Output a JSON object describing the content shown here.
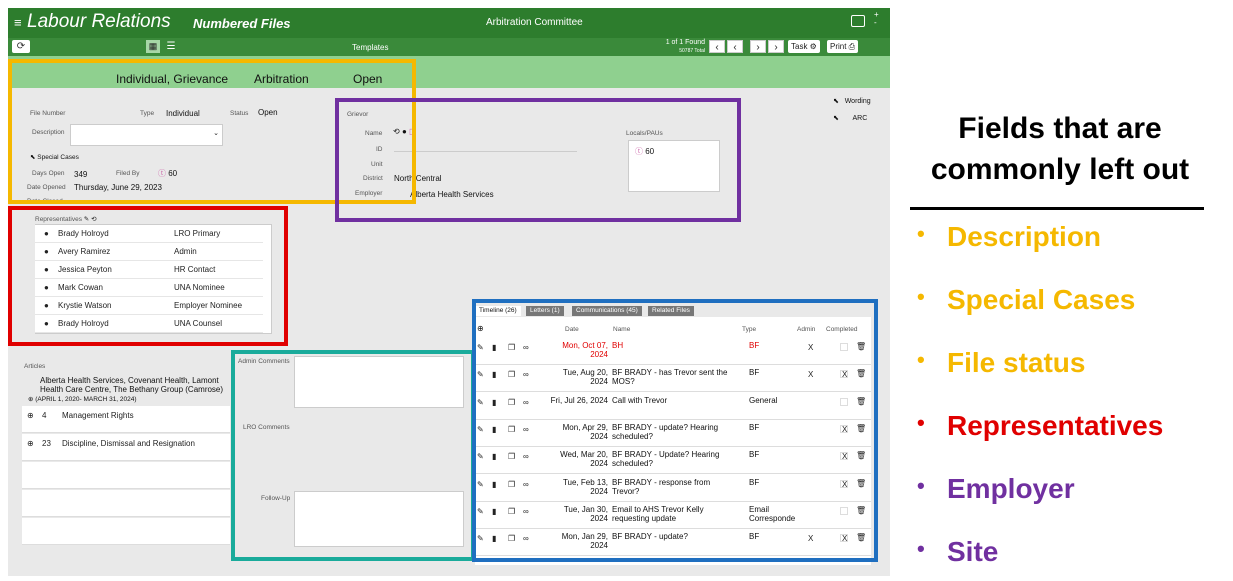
{
  "header": {
    "title": "Labour Relations",
    "subtitle": "Numbered Files",
    "center": "Arbitration Committee"
  },
  "toolbar": {
    "templates": "Templates",
    "found": "1 of 1 Found",
    "total": "50787 Total",
    "task": "Task",
    "print": "Print"
  },
  "status": {
    "type": "Individual, Grievance",
    "kind": "Arbitration",
    "state": "Open"
  },
  "file": {
    "file_number_label": "File Number",
    "type_label": "Type",
    "type_value": "Individual",
    "status_label": "Status",
    "status_value": "Open",
    "description_label": "Description",
    "special_cases": "Special Cases",
    "days_open_label": "Days Open",
    "days_open_value": "349",
    "filed_by_label": "Filed By",
    "filed_by_value": "60",
    "date_opened_label": "Date Opened",
    "date_opened_value": "Thursday, June 29, 2023",
    "date_closed_label": "Date Closed"
  },
  "grievor": {
    "title": "Grievor",
    "name_label": "Name",
    "id_label": "ID",
    "unit_label": "Unit",
    "district_label": "District",
    "district_value": "North Central",
    "employer_label": "Employer",
    "employer_value": "Alberta Health Services",
    "locals_label": "Locals/PAUs",
    "locals_value": "60"
  },
  "side_links": {
    "wording": "Wording",
    "arc": "ARC"
  },
  "representatives": {
    "label": "Representatives",
    "rows": [
      {
        "name": "Brady Holroyd",
        "role": "LRO Primary"
      },
      {
        "name": "Avery Ramirez",
        "role": "Admin"
      },
      {
        "name": "Jessica Peyton",
        "role": "HR Contact"
      },
      {
        "name": "Mark Cowan",
        "role": "UNA Nominee"
      },
      {
        "name": "Krystie Watson",
        "role": "Employer Nominee"
      },
      {
        "name": "Brady Holroyd",
        "role": "UNA Counsel"
      }
    ]
  },
  "articles": {
    "label": "Articles",
    "agreement_1": "Alberta Health Services, Covenant Health, Lamont",
    "agreement_2": "Health Care Centre, The Bethany Group (Camrose)",
    "agreement_3": "(APRIL 1, 2020- MARCH 31, 2024)",
    "rows": [
      {
        "num": "4",
        "title": "Management Rights"
      },
      {
        "num": "23",
        "title": "Discipline, Dismissal and Resignation"
      }
    ]
  },
  "comments": {
    "admin": "Admin Comments",
    "lro": "LRO Comments",
    "follow_up": "Follow-Up"
  },
  "timeline": {
    "tabs": [
      "Timeline (26)",
      "Letters (1)",
      "Communications (45)",
      "Related Files"
    ],
    "headers": {
      "date": "Date",
      "name": "Name",
      "type": "Type",
      "admin": "Admin",
      "completed": "Completed"
    },
    "rows": [
      {
        "date": "Mon, Oct 07, 2024",
        "name": "BH",
        "type": "BF",
        "admin": "X",
        "done": "",
        "red": true
      },
      {
        "date": "Tue, Aug 20, 2024",
        "name": "BF BRADY - has Trevor sent the MOS?",
        "type": "BF",
        "admin": "X",
        "done": "X",
        "red": false
      },
      {
        "date": "Fri, Jul 26, 2024",
        "name": "Call with Trevor",
        "type": "General",
        "admin": "",
        "done": "",
        "red": false
      },
      {
        "date": "Mon, Apr 29, 2024",
        "name": "BF BRADY - update? Hearing scheduled?",
        "type": "BF",
        "admin": "",
        "done": "X",
        "red": false
      },
      {
        "date": "Wed, Mar 20, 2024",
        "name": "BF BRADY - Update? Hearing scheduled?",
        "type": "BF",
        "admin": "",
        "done": "X",
        "red": false
      },
      {
        "date": "Tue, Feb 13, 2024",
        "name": "BF BRADY - response from Trevor?",
        "type": "BF",
        "admin": "",
        "done": "X",
        "red": false
      },
      {
        "date": "Tue, Jan 30, 2024",
        "name": "Email to AHS Trevor Kelly requesting update",
        "type": "Email Corresponde",
        "admin": "",
        "done": "",
        "red": false
      },
      {
        "date": "Mon, Jan 29, 2024",
        "name": "BF BRADY - update?",
        "type": "BF",
        "admin": "X",
        "done": "X",
        "red": false
      }
    ]
  },
  "callout": {
    "heading_1": "Fields that are",
    "heading_2": "commonly left out",
    "items": [
      {
        "text": "Description",
        "color": "#f5b800"
      },
      {
        "text": "Special Cases",
        "color": "#f5b800"
      },
      {
        "text": "File status",
        "color": "#f5b800"
      },
      {
        "text": "Representatives",
        "color": "#e00000"
      },
      {
        "text": "Employer",
        "color": "#7030a0"
      },
      {
        "text": "Site",
        "color": "#7030a0"
      }
    ]
  },
  "colors": {
    "header_green": "#2d7d2d",
    "status_green": "#8fd08f",
    "highlight_yellow": "#f5b800",
    "highlight_red": "#e00000",
    "highlight_purple": "#7030a0",
    "highlight_teal": "#1aab9b",
    "highlight_blue": "#1f6fc0"
  }
}
